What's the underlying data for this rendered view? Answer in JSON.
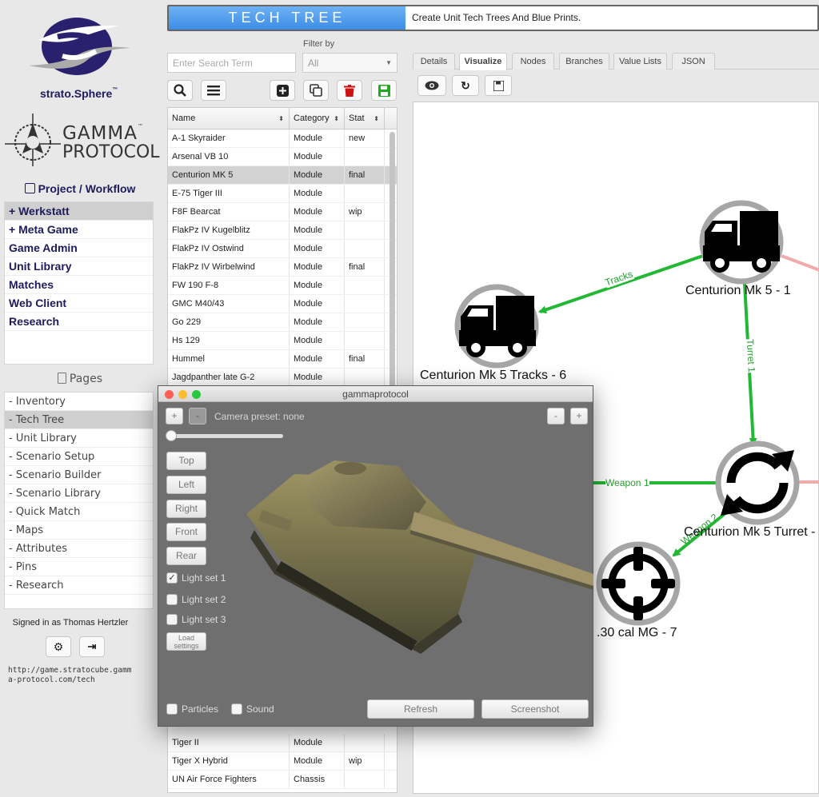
{
  "brand": {
    "strato": "strato.Sphere",
    "strato_tm": "™",
    "gamma_line1": "GAMMA",
    "gamma_line2": "PROTOCOL",
    "gamma_tm": "™"
  },
  "project_workflow": "Project / Workflow",
  "nav": [
    "+ Werkstatt",
    "+ Meta Game",
    "Game Admin",
    "Unit Library",
    "Matches",
    "Web Client",
    "Research"
  ],
  "pages_title": "Pages",
  "pages": [
    "- Inventory",
    "- Tech Tree",
    "- Unit Library",
    "- Scenario Setup",
    "- Scenario Builder",
    "- Scenario Library",
    "- Quick Match",
    "- Maps",
    "- Attributes",
    "- Pins",
    "- Research"
  ],
  "signed_in": "Signed in as Thomas Hertzler",
  "url": "http://game.stratocube.gamma-protocol.com/tech",
  "url_line1": "http://game.stratocube.gamm",
  "url_line2": "a-protocol.com/tech",
  "header": {
    "title": "TECH TREE",
    "subtitle": "Create Unit Tech Trees And Blue Prints."
  },
  "search": {
    "placeholder": "Enter Search Term"
  },
  "filter": {
    "label": "Filter by",
    "value": "All"
  },
  "table": {
    "headers": [
      "Name",
      "Category",
      "Stat"
    ],
    "rows": [
      [
        "A-1 Skyraider",
        "Module",
        "new"
      ],
      [
        "Arsenal VB 10",
        "Module",
        ""
      ],
      [
        "Centurion MK 5",
        "Module",
        "final"
      ],
      [
        "E-75 Tiger III",
        "Module",
        ""
      ],
      [
        "F8F Bearcat",
        "Module",
        "wip"
      ],
      [
        "FlakPz IV Kugelblitz",
        "Module",
        ""
      ],
      [
        "FlakPz IV Ostwind",
        "Module",
        ""
      ],
      [
        "FlakPz IV Wirbelwind",
        "Module",
        "final"
      ],
      [
        "FW 190 F-8",
        "Module",
        ""
      ],
      [
        "GMC M40/43",
        "Module",
        ""
      ],
      [
        "Go 229",
        "Module",
        ""
      ],
      [
        "Hs 129",
        "Module",
        ""
      ],
      [
        "Hummel",
        "Module",
        "final"
      ],
      [
        "Jagdpanther late G-2",
        "Module",
        ""
      ]
    ],
    "bottom_rows": [
      [
        "Tiger II",
        "Module",
        ""
      ],
      [
        "Tiger X Hybrid",
        "Module",
        "wip"
      ],
      [
        "UN Air Force Fighters",
        "Chassis",
        ""
      ]
    ]
  },
  "tabs": [
    "Details",
    "Visualize",
    "Nodes",
    "Branches",
    "Value Lists",
    "JSON"
  ],
  "graph": {
    "nodes": {
      "n1": "Centurion Mk 5 - 1",
      "n2": "Centurion Mk 5 Tracks - 6",
      "n3": "Centurion Mk 5 Turret -",
      "n4": ".30 cal MG - 7"
    },
    "edges": {
      "e1": "Tracks",
      "e2": "Turret 1",
      "e3": "Weapon 1",
      "e4": "Weapon 2"
    }
  },
  "popup": {
    "title": "gammaprotocol",
    "camera": "Camera preset: none",
    "views": [
      "Top",
      "Left",
      "Right",
      "Front",
      "Rear"
    ],
    "lights": [
      "Light set 1",
      "Light set 2",
      "Light set 3"
    ],
    "load_settings": "Load settings",
    "particles": "Particles",
    "sound": "Sound",
    "refresh": "Refresh",
    "screenshot": "Screenshot"
  }
}
